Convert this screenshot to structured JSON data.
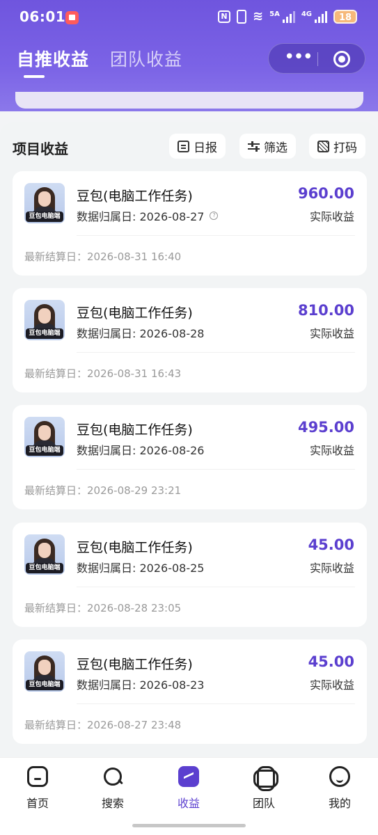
{
  "status": {
    "time": "06:01",
    "battery": "18",
    "network_5g_label": "5A",
    "network_4g_label": "4G"
  },
  "header": {
    "tabs": [
      {
        "label": "自推收益",
        "active": true
      },
      {
        "label": "团队收益",
        "active": false
      }
    ],
    "capsule_more": "•••"
  },
  "section": {
    "title": "项目收益",
    "buttons": {
      "daily": "日报",
      "filter": "筛选",
      "code": "打码"
    }
  },
  "cards": [
    {
      "title": "豆包(电脑工作任务)",
      "avatar_tag": "豆包电脑端",
      "date": "数据归属日: 2026-08-27",
      "has_info": true,
      "amount": "960.00",
      "amount_label": "实际收益",
      "settle": "最新结算日：2026-08-31 16:40"
    },
    {
      "title": "豆包(电脑工作任务)",
      "avatar_tag": "豆包电脑端",
      "date": "数据归属日: 2026-08-28",
      "has_info": false,
      "amount": "810.00",
      "amount_label": "实际收益",
      "settle": "最新结算日：2026-08-31 16:43"
    },
    {
      "title": "豆包(电脑工作任务)",
      "avatar_tag": "豆包电脑端",
      "date": "数据归属日: 2026-08-26",
      "has_info": false,
      "amount": "495.00",
      "amount_label": "实际收益",
      "settle": "最新结算日：2026-08-29 23:21"
    },
    {
      "title": "豆包(电脑工作任务)",
      "avatar_tag": "豆包电脑端",
      "date": "数据归属日: 2026-08-25",
      "has_info": false,
      "amount": "45.00",
      "amount_label": "实际收益",
      "settle": "最新结算日：2026-08-28 23:05"
    },
    {
      "title": "豆包(电脑工作任务)",
      "avatar_tag": "豆包电脑端",
      "date": "数据归属日: 2026-08-23",
      "has_info": false,
      "amount": "45.00",
      "amount_label": "实际收益",
      "settle": "最新结算日：2026-08-27 23:48"
    }
  ],
  "nav": [
    {
      "label": "首页",
      "icon": "home-icon",
      "active": false
    },
    {
      "label": "搜索",
      "icon": "search-icon",
      "active": false
    },
    {
      "label": "收益",
      "icon": "earnings-icon",
      "active": true
    },
    {
      "label": "团队",
      "icon": "team-icon",
      "active": false
    },
    {
      "label": "我的",
      "icon": "me-icon",
      "active": false
    }
  ],
  "colors": {
    "header": "#6f55de",
    "accent": "#5b3fcf"
  }
}
